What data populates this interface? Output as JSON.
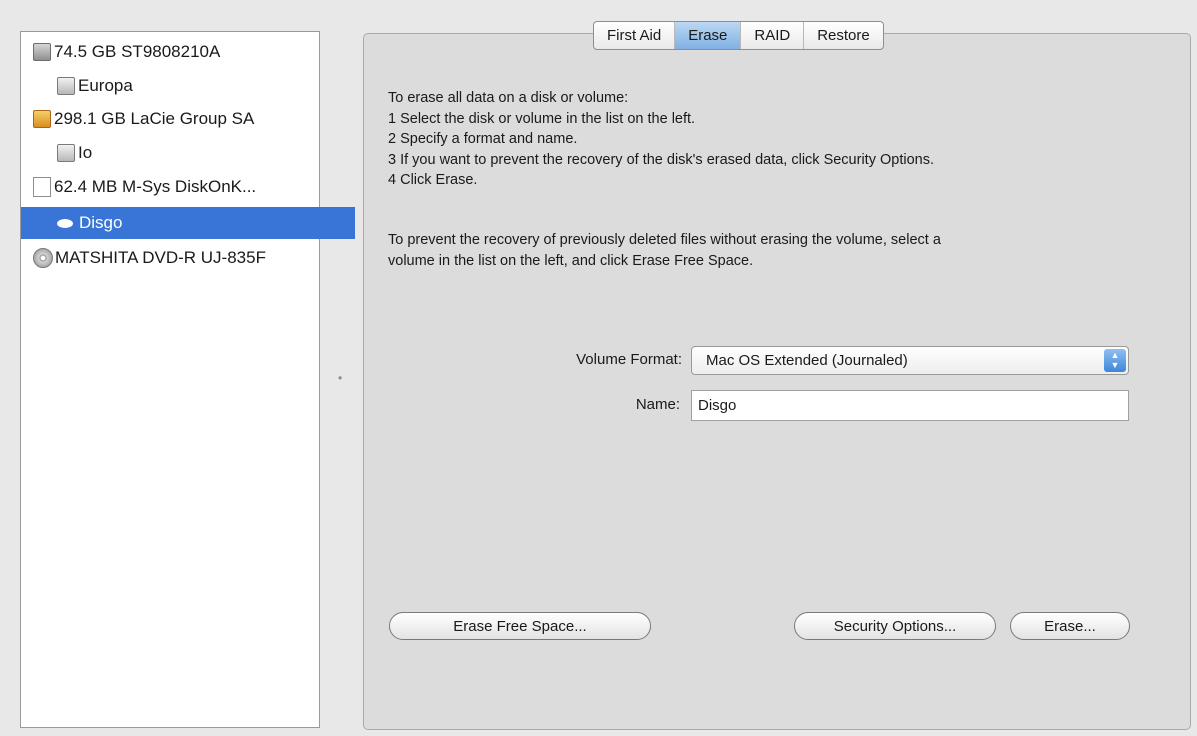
{
  "sidebar": {
    "items": [
      {
        "label": "74.5 GB ST9808210A",
        "icon": "internal-hard-disk-icon"
      },
      {
        "label": "Europa",
        "icon": "volume-icon"
      },
      {
        "label": "298.1 GB LaCie Group SA",
        "icon": "external-hard-disk-icon"
      },
      {
        "label": "Io",
        "icon": "volume-icon"
      },
      {
        "label": "62.4 MB M-Sys DiskOnK...",
        "icon": "usb-drive-icon"
      },
      {
        "label": "Disgo",
        "icon": "removable-volume-icon",
        "selected": true
      },
      {
        "label": "MATSHITA DVD-R UJ-835F",
        "icon": "optical-drive-icon"
      }
    ]
  },
  "tabs": [
    {
      "label": "First Aid"
    },
    {
      "label": "Erase",
      "active": true
    },
    {
      "label": "RAID"
    },
    {
      "label": "Restore"
    }
  ],
  "instructions": {
    "lines": [
      "To erase all data on a disk or volume:",
      "1 Select the disk or volume in the list on the left.",
      "2 Specify a format and name.",
      "3 If you want to prevent the recovery of the disk's erased data, click Security Options.",
      "4 Click Erase."
    ],
    "free_space_lines": [
      "To prevent the recovery of previously deleted files without erasing the volume, select a",
      "volume in the list on the left, and click Erase Free Space."
    ]
  },
  "form": {
    "volume_format_label": "Volume Format:",
    "volume_format_value": "Mac OS Extended (Journaled)",
    "name_label": "Name:",
    "name_value": "Disgo"
  },
  "buttons": {
    "erase_free_space": "Erase Free Space...",
    "security_options": "Security Options...",
    "erase": "Erase..."
  },
  "colors": {
    "selection": "#3875d7",
    "active_tab": "#7fb1e4",
    "panel_bg": "#dcdcdc",
    "window_bg": "#e8e8e8"
  }
}
